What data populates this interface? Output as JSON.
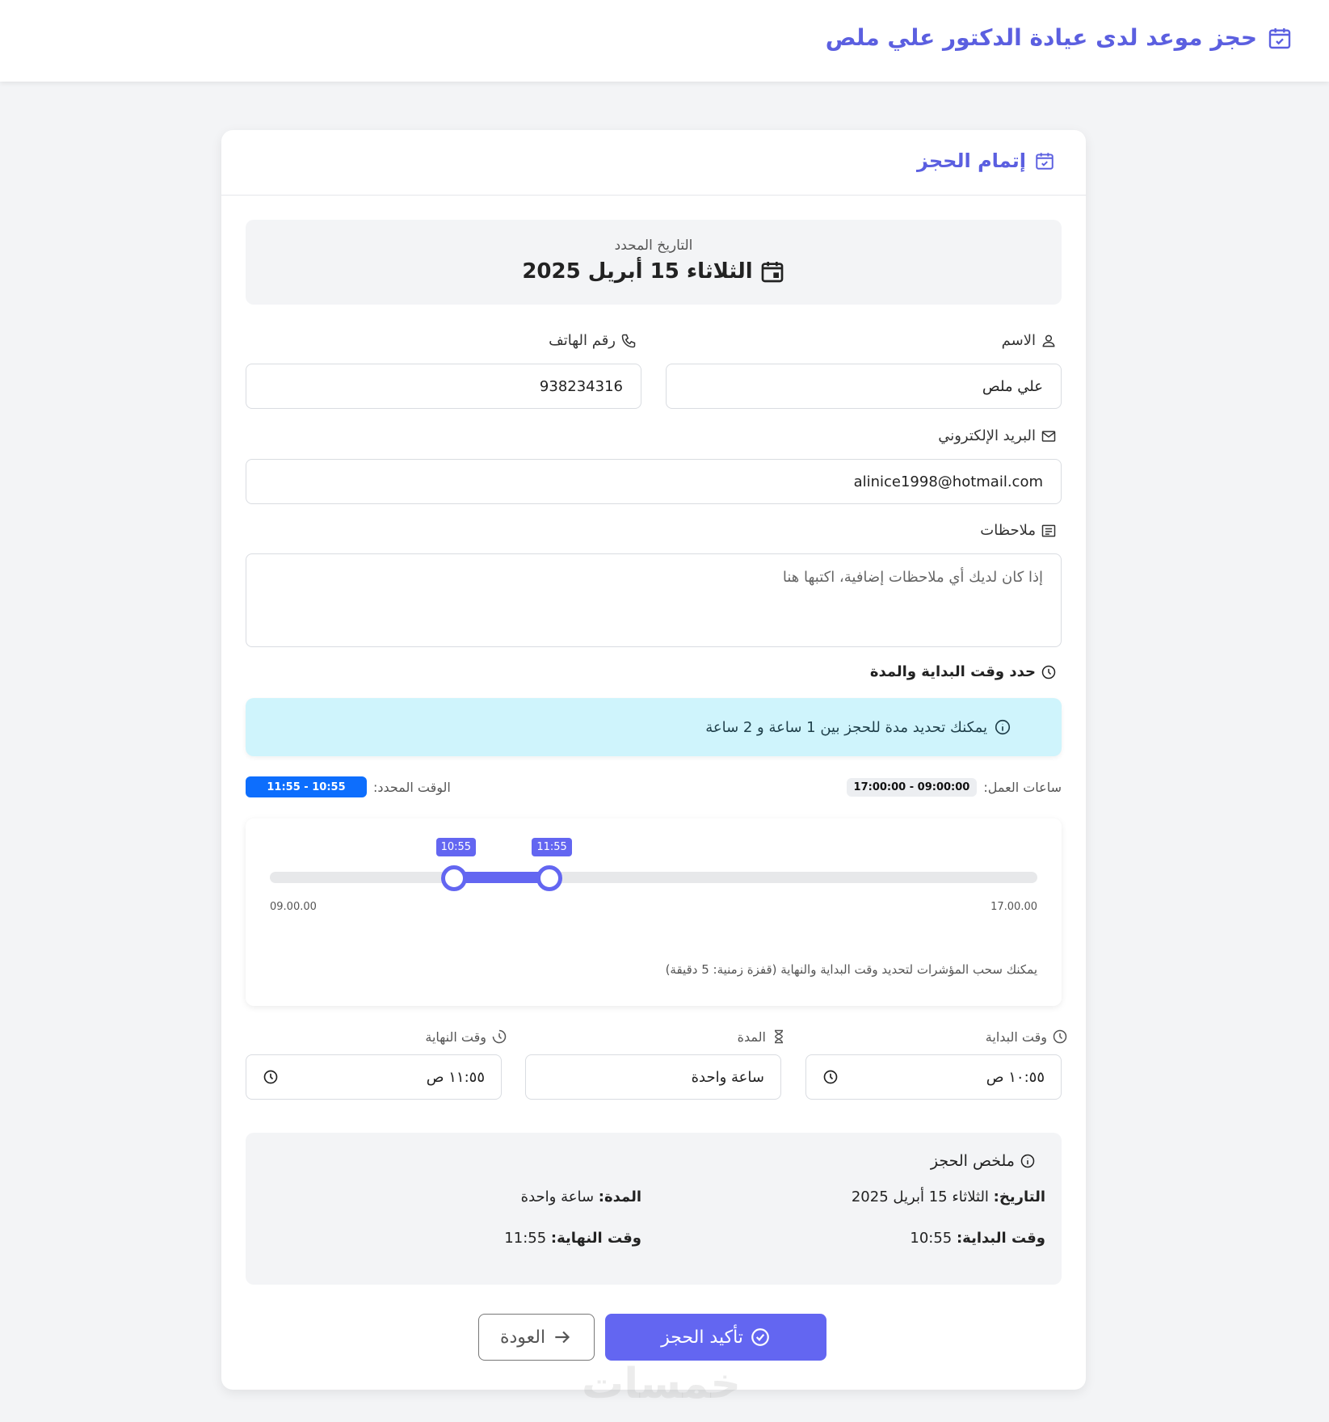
{
  "header": {
    "title": "حجز موعد لدى عيادة الدكتور علي ملص",
    "icon": "calendar-check-icon"
  },
  "card": {
    "title": "إتمام الحجز"
  },
  "selected_date": {
    "label": "التاريخ المحدد",
    "value": "الثلاثاء 15 أبريل 2025"
  },
  "form": {
    "name_label": "الاسم",
    "name_value": "علي ملص",
    "phone_label": "رقم الهاتف",
    "phone_value": "938234316",
    "email_label": "البريد الإلكتروني",
    "email_value": "alinice1998@hotmail.com",
    "notes_label": "ملاحظات",
    "notes_placeholder": "إذا كان لديك أي ملاحظات إضافية، اكتبها هنا"
  },
  "time_section": {
    "title": "حدد وقت البداية والمدة",
    "info": "يمكنك تحديد مدة للحجز بين 1 ساعة و 2 ساعة",
    "working_hours_label": "ساعات العمل:",
    "working_hours_value": "09:00:00 - 17:00:00",
    "selected_time_label": "الوقت المحدد:",
    "selected_time_value": "10:55 - 11:55"
  },
  "slider": {
    "min_label": "09.00.00",
    "max_label": "17.00.00",
    "range_start": "10:55",
    "range_end": "11:55",
    "start_fraction": 0.2396,
    "end_fraction": 0.3646,
    "hint": "يمكنك سحب المؤشرات لتحديد وقت البداية والنهاية (قفزة زمنية: 5 دقيقة)"
  },
  "time_fields": {
    "start_label": "وقت البداية",
    "start_value": "١٠:٥٥ ص",
    "duration_label": "المدة",
    "duration_value": "ساعة واحدة",
    "end_label": "وقت النهاية",
    "end_value": "١١:٥٥ ص"
  },
  "summary": {
    "title": "ملخص الحجز",
    "date_label": "التاريخ:",
    "date_value": "الثلاثاء 15 أبريل 2025",
    "duration_label": "المدة:",
    "duration_value": "ساعة واحدة",
    "start_label": "وقت البداية:",
    "start_value": "10:55",
    "end_label": "وقت النهاية:",
    "end_value": "11:55"
  },
  "buttons": {
    "confirm": "تأكيد الحجز",
    "back": "العودة"
  },
  "watermark": "خمسات",
  "colors": {
    "accent": "#6366f1",
    "info_bg": "#cff4fc",
    "badge_blue": "#0d6efd"
  }
}
